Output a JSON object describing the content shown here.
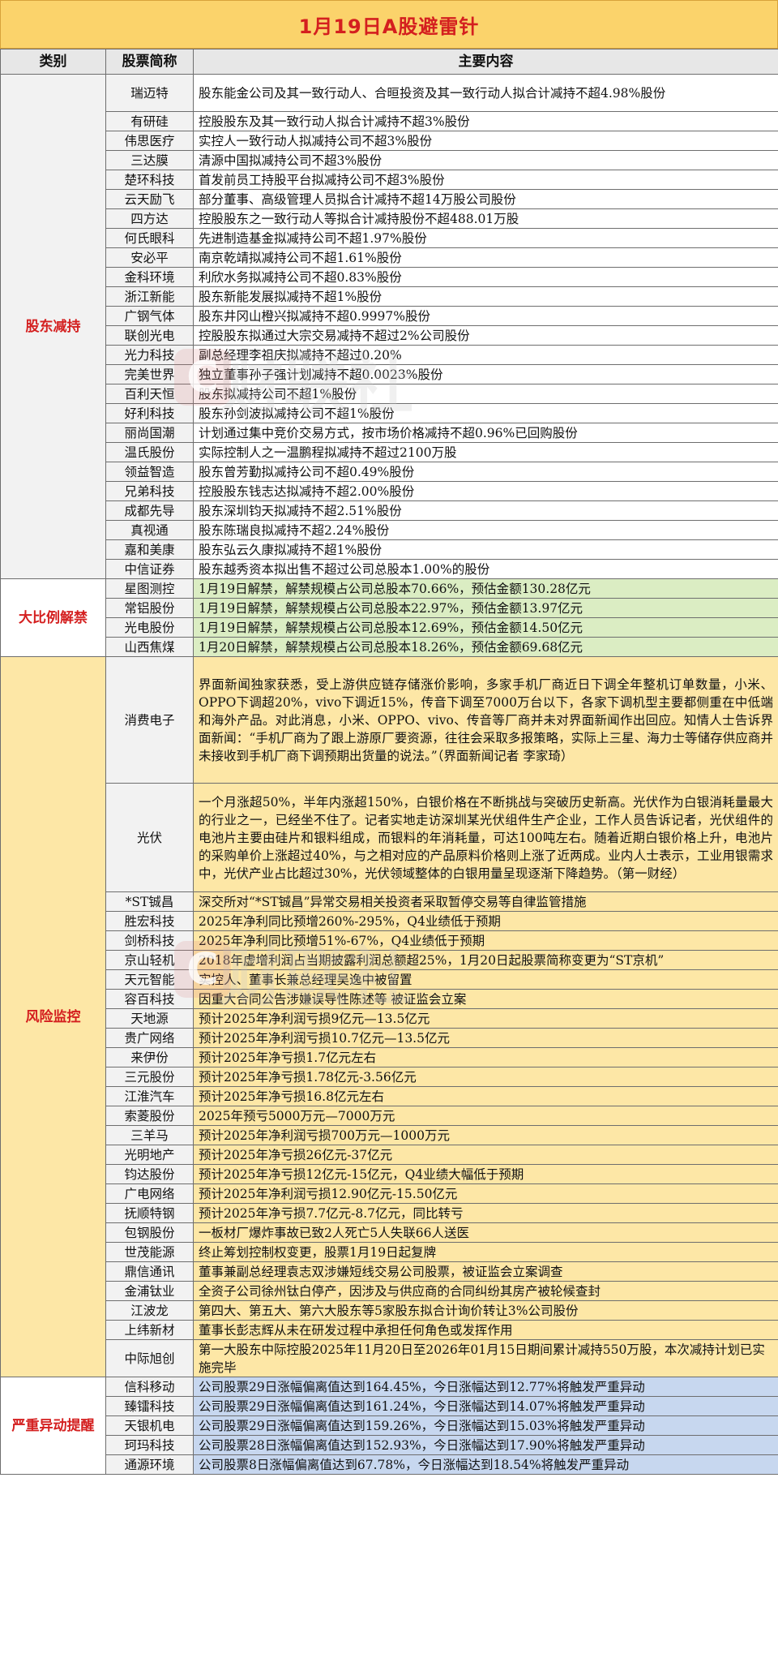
{
  "title": "1月19日A股避雷针",
  "header": {
    "col_category": "类别",
    "col_stock": "股票简称",
    "col_content": "主要内容"
  },
  "watermark": {
    "text": "财联社",
    "badge": "C"
  },
  "sections": [
    {
      "category": "股东减持",
      "style": "s-share",
      "rows": [
        {
          "name": "瑞迈特",
          "content": "股东能金公司及其一致行动人、合晅投资及其一致行动人拟合计减持不超4.98%股份",
          "lines": 2
        },
        {
          "name": "有研硅",
          "content": "控股股东及其一致行动人拟合计减持不超3%股份",
          "lines": 1
        },
        {
          "name": "伟思医疗",
          "content": "实控人一致行动人拟减持公司不超3%股份",
          "lines": 1
        },
        {
          "name": "三达膜",
          "content": "清源中国拟减持公司不超3%股份",
          "lines": 1
        },
        {
          "name": "楚环科技",
          "content": "首发前员工持股平台拟减持公司不超3%股份",
          "lines": 1
        },
        {
          "name": "云天励飞",
          "content": "部分董事、高级管理人员拟合计减持不超14万股公司股份",
          "lines": 1
        },
        {
          "name": "四方达",
          "content": "控股股东之一致行动人等拟合计减持股份不超488.01万股",
          "lines": 1
        },
        {
          "name": "何氏眼科",
          "content": "先进制造基金拟减持公司不超1.97%股份",
          "lines": 1
        },
        {
          "name": "安必平",
          "content": "南京乾靖拟减持公司不超1.61%股份",
          "lines": 1
        },
        {
          "name": "金科环境",
          "content": "利欣水务拟减持公司不超0.83%股份",
          "lines": 1
        },
        {
          "name": "浙江新能",
          "content": "股东新能发展拟减持不超1%股份",
          "lines": 1
        },
        {
          "name": "广钢气体",
          "content": "股东井冈山橙兴拟减持不超0.9997%股份",
          "lines": 1
        },
        {
          "name": "联创光电",
          "content": "控股股东拟通过大宗交易减持不超过2%公司股份",
          "lines": 1
        },
        {
          "name": "光力科技",
          "content": "副总经理李祖庆拟减持不超过0.20%",
          "lines": 1
        },
        {
          "name": "完美世界",
          "content": "独立董事孙子强计划减持不超0.0023%股份",
          "lines": 1
        },
        {
          "name": "百利天恒",
          "content": "股东拟减持公司不超1%股份",
          "lines": 1
        },
        {
          "name": "好利科技",
          "content": "股东孙剑波拟减持公司不超1%股份",
          "lines": 1
        },
        {
          "name": "丽尚国潮",
          "content": "计划通过集中竞价交易方式，按市场价格减持不超0.96%已回购股份",
          "lines": 1
        },
        {
          "name": "温氏股份",
          "content": "实际控制人之一温鹏程拟减持不超过2100万股",
          "lines": 1
        },
        {
          "name": "领益智造",
          "content": "股东曾芳勤拟减持公司不超0.49%股份",
          "lines": 1
        },
        {
          "name": "兄弟科技",
          "content": "控股股东钱志达拟减持不超2.00%股份",
          "lines": 1
        },
        {
          "name": "成都先导",
          "content": "股东深圳钧天拟减持不超2.51%股份",
          "lines": 1
        },
        {
          "name": "真视通",
          "content": "股东陈瑞良拟减持不超2.24%股份",
          "lines": 1
        },
        {
          "name": "嘉和美康",
          "content": "股东弘云久康拟减持不超1%股份",
          "lines": 1
        },
        {
          "name": "中信证券",
          "content": "股东越秀资本拟出售不超过公司总股本1.00%的股份",
          "lines": 1
        }
      ]
    },
    {
      "category": "大比例解禁",
      "style": "s-unlock",
      "rows": [
        {
          "name": "星图测控",
          "content": "1月19日解禁，解禁规模占公司总股本70.66%，预估金额130.28亿元",
          "lines": 1
        },
        {
          "name": "常铝股份",
          "content": "1月19日解禁，解禁规模占公司总股本22.97%，预估金额13.97亿元",
          "lines": 1
        },
        {
          "name": "光电股份",
          "content": "1月19日解禁，解禁规模占公司总股本12.69%，预估金额14.50亿元",
          "lines": 1
        },
        {
          "name": "山西焦煤",
          "content": "1月20日解禁，解禁规模占公司总股本18.26%，预估金额69.68亿元",
          "lines": 1
        }
      ]
    },
    {
      "category": "风险监控",
      "style": "s-risk",
      "rows": [
        {
          "name": "消费电子",
          "content": "界面新闻独家获悉，受上游供应链存储涨价影响，多家手机厂商近日下调全年整机订单数量，小米、OPPO下调超20%，vivo下调近15%，传音下调至7000万台以下，各家下调机型主要都侧重在中低端和海外产品。对此消息，小米、OPPO、vivo、传音等厂商并未对界面新闻作出回应。知情人士告诉界面新闻：“手机厂商为了跟上游原厂要资源，往往会采取多报策略，实际上三星、海力士等储存供应商并未接收到手机厂商下调预期出货量的说法。”（界面新闻记者 李家琦）",
          "lines": 7,
          "justify": true
        },
        {
          "name": "光伏",
          "content": "一个月涨超50%，半年内涨超150%，白银价格在不断挑战与突破历史新高。光伏作为白银消耗量最大的行业之一，已经坐不住了。记者实地走访深圳某光伏组件生产企业，工作人员告诉记者，光伏组件的电池片主要由硅片和银料组成，而银料的年消耗量，可达100吨左右。随着近期白银价格上升，电池片的采购单价上涨超过40%，与之相对应的产品原料价格则上涨了近两成。业内人士表示，工业用银需求中，光伏产业占比超过30%，光伏领域整体的白银用量呈现逐渐下降趋势。（第一财经）",
          "lines": 6,
          "justify": true
        },
        {
          "name": "*ST铖昌",
          "content": "深交所对“*ST铖昌”异常交易相关投资者采取暂停交易等自律监管措施",
          "lines": 1
        },
        {
          "name": "胜宏科技",
          "content": "2025年净利同比预增260%-295%，Q4业绩低于预期",
          "lines": 1
        },
        {
          "name": "剑桥科技",
          "content": "2025年净利同比预增51%-67%，Q4业绩低于预期",
          "lines": 1
        },
        {
          "name": "京山轻机",
          "content": "2018年虚增利润占当期披露利润总额超25%，1月20日起股票简称变更为“ST京机”",
          "lines": 1
        },
        {
          "name": "天元智能",
          "content": "实控人、董事长兼总经理吴逸中被留置",
          "lines": 1
        },
        {
          "name": "容百科技",
          "content": "因重大合同公告涉嫌误导性陈述等 被证监会立案",
          "lines": 1
        },
        {
          "name": "天地源",
          "content": "预计2025年净利润亏损9亿元—13.5亿元",
          "lines": 1
        },
        {
          "name": "贵广网络",
          "content": "预计2025年净利润亏损10.7亿元—13.5亿元",
          "lines": 1
        },
        {
          "name": "来伊份",
          "content": "预计2025年净亏损1.7亿元左右",
          "lines": 1
        },
        {
          "name": "三元股份",
          "content": "预计2025年净亏损1.78亿元-3.56亿元",
          "lines": 1
        },
        {
          "name": "江淮汽车",
          "content": "预计2025年净亏损16.8亿元左右",
          "lines": 1
        },
        {
          "name": "索菱股份",
          "content": "2025年预亏5000万元—7000万元",
          "lines": 1
        },
        {
          "name": "三羊马",
          "content": "预计2025年净利润亏损700万元—1000万元",
          "lines": 1
        },
        {
          "name": "光明地产",
          "content": "预计2025年净亏损26亿元-37亿元",
          "lines": 1
        },
        {
          "name": "钧达股份",
          "content": "预计2025年净亏损12亿元-15亿元，Q4业绩大幅低于预期",
          "lines": 1
        },
        {
          "name": "广电网络",
          "content": "预计2025年净利润亏损12.90亿元-15.50亿元",
          "lines": 1
        },
        {
          "name": "抚顺特钢",
          "content": "预计2025年净亏损7.7亿元-8.7亿元，同比转亏",
          "lines": 1
        },
        {
          "name": "包钢股份",
          "content": "一板材厂爆炸事故已致2人死亡5人失联66人送医",
          "lines": 1
        },
        {
          "name": "世茂能源",
          "content": "终止筹划控制权变更，股票1月19日起复牌",
          "lines": 1
        },
        {
          "name": "鼎信通讯",
          "content": "董事兼副总经理袁志双涉嫌短线交易公司股票，被证监会立案调查",
          "lines": 1
        },
        {
          "name": "金浦钛业",
          "content": "全资子公司徐州钛白停产，因涉及与供应商的合同纠纷其房产被轮候查封",
          "lines": 1
        },
        {
          "name": "江波龙",
          "content": "第四大、第五大、第六大股东等5家股东拟合计询价转让3%公司股份",
          "lines": 1
        },
        {
          "name": "上纬新材",
          "content": "董事长彭志辉从未在研发过程中承担任何角色或发挥作用",
          "lines": 1
        },
        {
          "name": "中际旭创",
          "content": "第一大股东中际控股2025年11月20日至2026年01月15日期间累计减持550万股，本次减持计划已实施完毕",
          "lines": 2
        }
      ]
    },
    {
      "category": "严重异动提醒",
      "style": "s-alert",
      "rows": [
        {
          "name": "信科移动",
          "content": "公司股票29日涨幅偏离值达到164.45%，今日涨幅达到12.77%将触发严重异动",
          "lines": 1
        },
        {
          "name": "臻镭科技",
          "content": "公司股票29日涨幅偏离值达到161.24%，今日涨幅达到14.07%将触发严重异动",
          "lines": 1
        },
        {
          "name": "天银机电",
          "content": "公司股票29日涨幅偏离值达到159.26%，今日涨幅达到15.03%将触发严重异动",
          "lines": 1
        },
        {
          "name": "珂玛科技",
          "content": "公司股票28日涨幅偏离值达到152.93%，今日涨幅达到17.90%将触发严重异动",
          "lines": 1
        },
        {
          "name": "通源环境",
          "content": "公司股票8日涨幅偏离值达到67.78%，今日涨幅达到18.54%将触发严重异动",
          "lines": 1
        }
      ]
    }
  ]
}
